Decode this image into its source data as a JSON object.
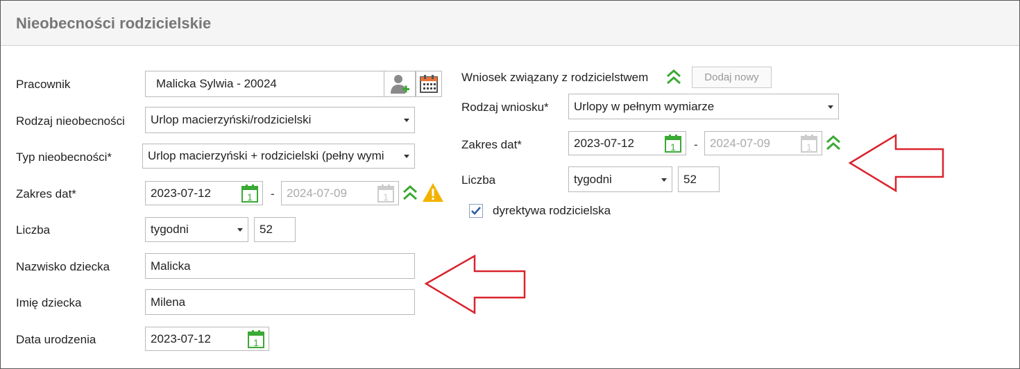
{
  "panel": {
    "title": "Nieobecności rodzicielskie"
  },
  "left": {
    "pracownik": {
      "label": "Pracownik",
      "value": "Malicka Sylwia - 20024"
    },
    "rodzaj": {
      "label": "Rodzaj nieobecności",
      "value": "Urlop macierzyński/rodzicielski"
    },
    "typ": {
      "label": "Typ nieobecności*",
      "value": "Urlop macierzyński + rodzicielski (pełny wymi"
    },
    "zakres": {
      "label": "Zakres dat*",
      "from": "2023-07-12",
      "separator": "-",
      "to": "2024-07-09"
    },
    "liczba": {
      "label": "Liczba",
      "unit": "tygodni",
      "value": "52"
    },
    "nazwisko": {
      "label": "Nazwisko dziecka",
      "value": "Malicka"
    },
    "imie": {
      "label": "Imię dziecka",
      "value": "Milena"
    },
    "urodzenie": {
      "label": "Data urodzenia",
      "value": "2023-07-12"
    },
    "calendar_day": "1"
  },
  "right": {
    "wniosek": {
      "label": "Wniosek związany z rodzicielstwem",
      "button": "Dodaj nowy"
    },
    "rodzaj_wniosku": {
      "label": "Rodzaj wniosku*",
      "value": "Urlopy w pełnym wymiarze"
    },
    "zakres": {
      "label": "Zakres dat*",
      "from": "2023-07-12",
      "separator": "-",
      "to": "2024-07-09"
    },
    "liczba": {
      "label": "Liczba",
      "unit": "tygodni",
      "value": "52"
    },
    "dyrektywa": {
      "label": "dyrektywa rodzicielska",
      "checked": true
    }
  },
  "colors": {
    "accent_green": "#3aa935",
    "calendar_orange": "#e8743b",
    "warning": "#f2b300",
    "arrow": "#d9232d"
  }
}
